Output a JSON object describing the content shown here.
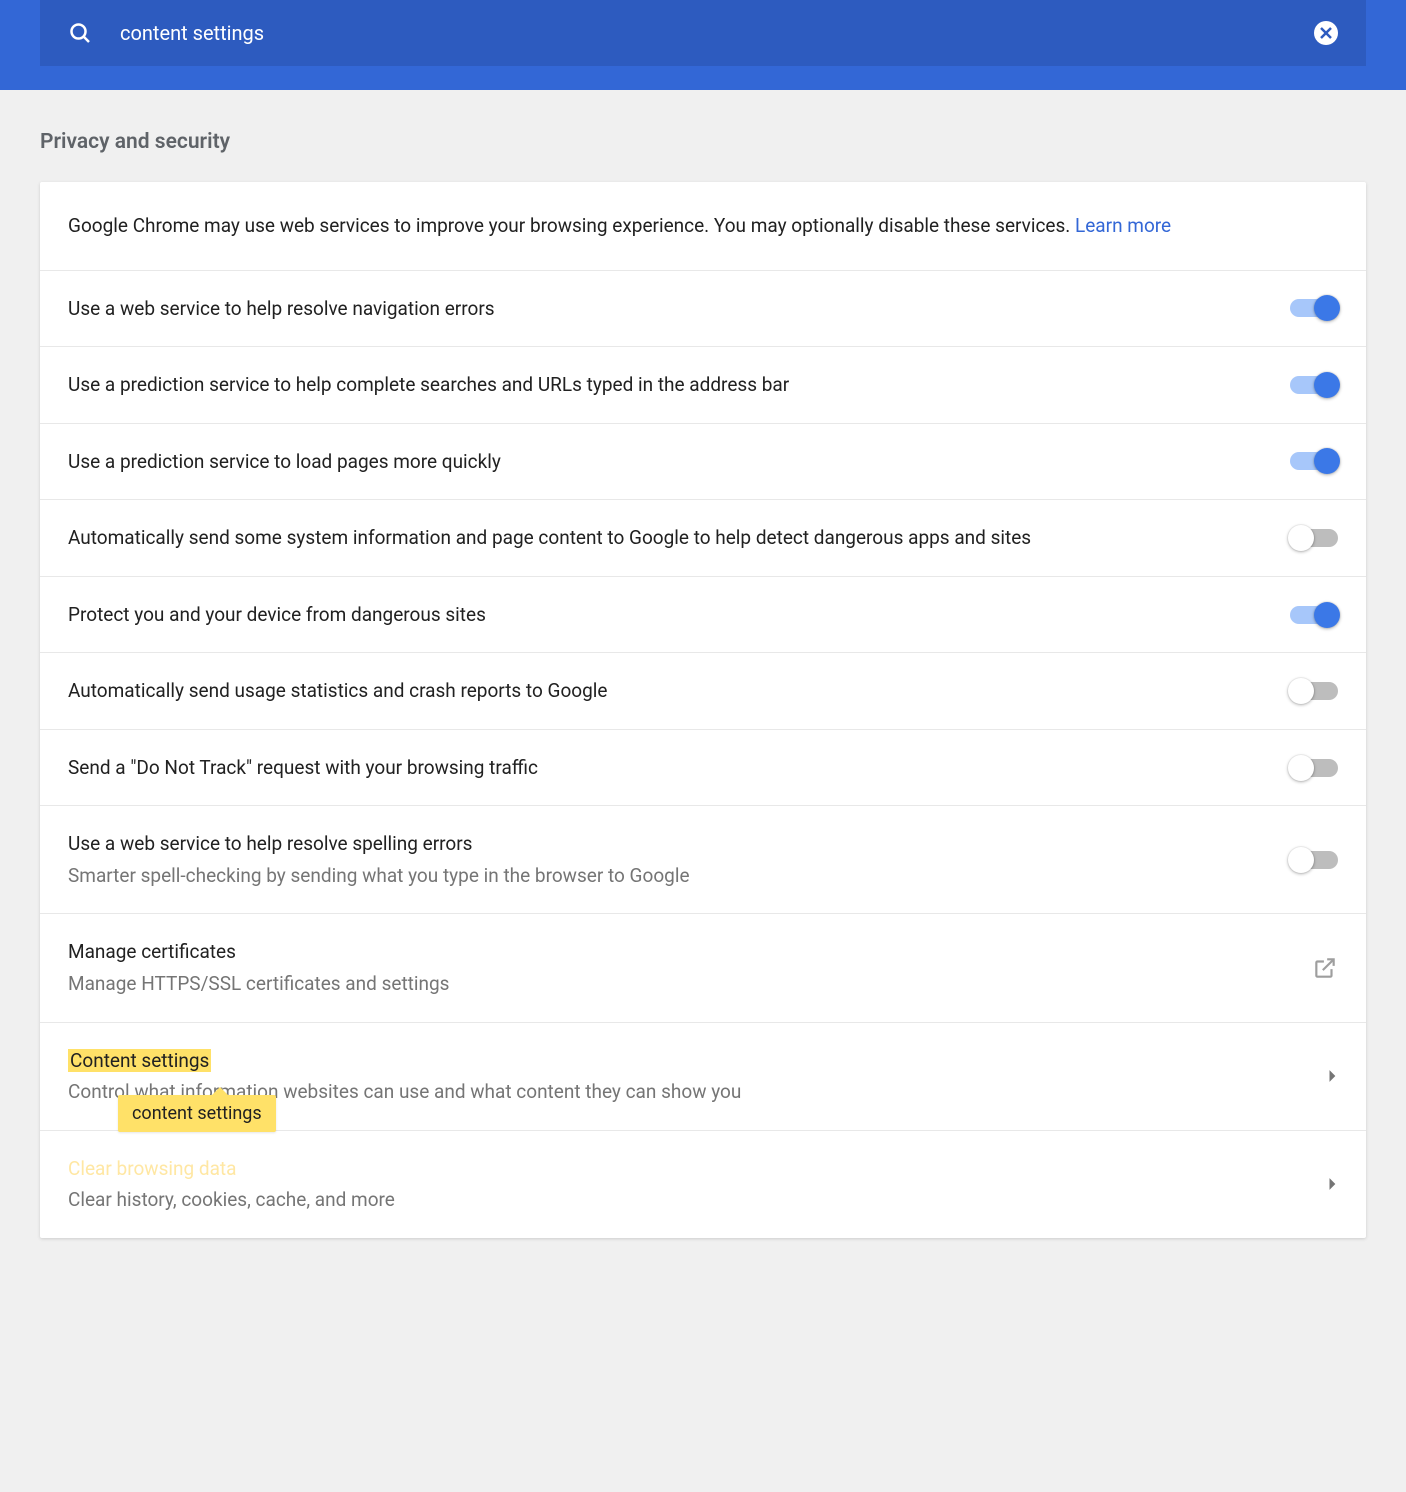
{
  "search": {
    "value": "content settings"
  },
  "section": {
    "title": "Privacy and security",
    "intro_text": "Google Chrome may use web services to improve your browsing experience. You may optionally disable these services. ",
    "learn_more": "Learn more",
    "rows": [
      {
        "title": "Use a web service to help resolve navigation errors",
        "sub": "",
        "toggle": true
      },
      {
        "title": "Use a prediction service to help complete searches and URLs typed in the address bar",
        "sub": "",
        "toggle": true
      },
      {
        "title": "Use a prediction service to load pages more quickly",
        "sub": "",
        "toggle": true
      },
      {
        "title": "Automatically send some system information and page content to Google to help detect dangerous apps and sites",
        "sub": "",
        "toggle": false
      },
      {
        "title": "Protect you and your device from dangerous sites",
        "sub": "",
        "toggle": true
      },
      {
        "title": "Automatically send usage statistics and crash reports to Google",
        "sub": "",
        "toggle": false
      },
      {
        "title": "Send a \"Do Not Track\" request with your browsing traffic",
        "sub": "",
        "toggle": false
      },
      {
        "title": "Use a web service to help resolve spelling errors",
        "sub": "Smarter spell-checking by sending what you type in the browser to Google",
        "toggle": false
      }
    ],
    "manage_certs": {
      "title": "Manage certificates",
      "sub": "Manage HTTPS/SSL certificates and settings"
    },
    "content_settings": {
      "title": "Content settings",
      "sub": "Control what information websites can use and what content they can show you"
    },
    "clear_browsing": {
      "title": "Clear browsing data",
      "sub": "Clear history, cookies, cache, and more"
    },
    "tooltip": "content settings"
  }
}
